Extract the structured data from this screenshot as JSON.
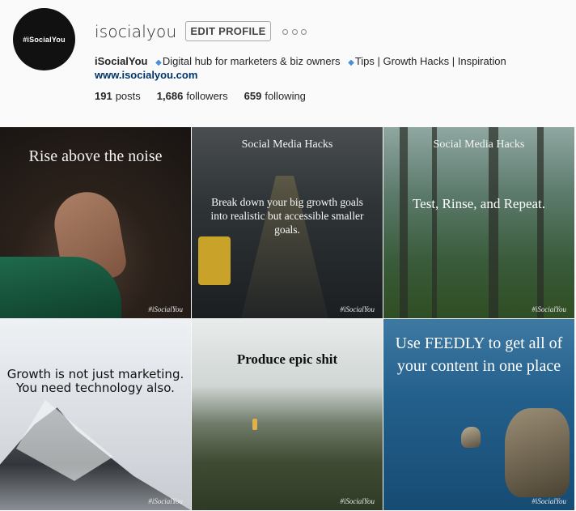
{
  "profile": {
    "username": "isocialyou",
    "avatar_text": "#iSocialYou",
    "edit_button": "EDIT PROFILE",
    "display_name": "iSocialYou",
    "bio_part1": "Digital hub for marketers & biz owners",
    "bio_part2": "Tips | Growth Hacks | Inspiration",
    "website": "www.isocialyou.com",
    "stats": {
      "posts_count": "191",
      "posts_label": "posts",
      "followers_count": "1,686",
      "followers_label": "followers",
      "following_count": "659",
      "following_label": "following"
    }
  },
  "posts": [
    {
      "title": "Rise above the noise",
      "watermark": "#iSocialYou"
    },
    {
      "title": "Social Media Hacks",
      "body": "Break down your big growth goals into realistic but accessible smaller goals.",
      "watermark": "#iSocialYou"
    },
    {
      "title": "Social Media Hacks",
      "body": "Test, Rinse, and Repeat.",
      "watermark": "#iSocialYou"
    },
    {
      "body": "Growth is not just marketing. You need technology also.",
      "watermark": "#iSocialYou"
    },
    {
      "title": "Produce epic shit",
      "watermark": "#iSocialYou"
    },
    {
      "body": "Use FEEDLY to get all of your content in one place",
      "watermark": "#iSocialYou"
    }
  ],
  "colors": {
    "link": "#003569",
    "diamond": "#4a90d9"
  },
  "icons": {
    "more": "more-options-icon",
    "diamond": "diamond-icon"
  }
}
